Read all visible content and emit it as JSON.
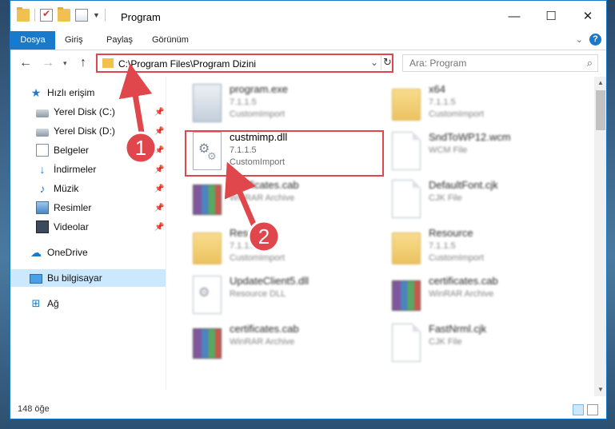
{
  "window": {
    "title": "Program"
  },
  "window_controls": {
    "minimize": "—",
    "maximize": "☐",
    "close": "✕"
  },
  "ribbon": {
    "tabs": [
      "Dosya",
      "Giriş",
      "Paylaş",
      "Görünüm"
    ],
    "help": "?"
  },
  "address": {
    "path": "C:\\Program Files\\Program Dizini",
    "refresh": "↻",
    "search_placeholder": "Ara: Program"
  },
  "nav": {
    "back": "←",
    "forward": "→",
    "recent": "▾",
    "up": "↑"
  },
  "sidebar": {
    "items": [
      {
        "label": "Hızlı erişim",
        "icon": "star-icon"
      },
      {
        "label": "Yerel Disk (C:)",
        "icon": "disk-icon",
        "pinned": true
      },
      {
        "label": "Yerel Disk (D:)",
        "icon": "disk-icon",
        "pinned": true
      },
      {
        "label": "Belgeler",
        "icon": "documents-icon",
        "pinned": true
      },
      {
        "label": "İndirmeler",
        "icon": "downloads-icon",
        "pinned": true
      },
      {
        "label": "Müzik",
        "icon": "music-icon",
        "pinned": true
      },
      {
        "label": "Resimler",
        "icon": "pictures-icon",
        "pinned": true
      },
      {
        "label": "Videolar",
        "icon": "videos-icon",
        "pinned": true
      },
      {
        "label": "OneDrive",
        "icon": "onedrive-icon"
      },
      {
        "label": "Bu bilgisayar",
        "icon": "computer-icon",
        "selected": true
      },
      {
        "label": "Ağ",
        "icon": "network-icon"
      }
    ]
  },
  "files": [
    {
      "name": "program.exe",
      "line2": "7.1.1.5",
      "line3": "CustomImport",
      "icon": "exe-icon"
    },
    {
      "name": "x64",
      "line2": "7.1.1.5",
      "line3": "CustomImport",
      "icon": "folder-icon"
    },
    {
      "name": "custmimp.dll",
      "line2": "7.1.1.5",
      "line3": "CustomImport",
      "icon": "dll-file-icon",
      "highlighted": true
    },
    {
      "name": "SndToWP12.wcm",
      "line2": "WCM File",
      "line3": "",
      "icon": "file-icon"
    },
    {
      "name": "certificates.cab",
      "line2": "WinRAR Archive",
      "line3": "",
      "icon": "archive-icon"
    },
    {
      "name": "DefaultFont.cjk",
      "line2": "CJK File",
      "line3": "",
      "icon": "file-icon"
    },
    {
      "name": "Resource",
      "line2": "7.1.1.5",
      "line3": "CustomImport",
      "icon": "folder-icon"
    },
    {
      "name": "Resource",
      "line2": "7.1.1.5",
      "line3": "CustomImport",
      "icon": "folder-icon"
    },
    {
      "name": "UpdateClient5.dll",
      "line2": "Resource DLL",
      "line3": "",
      "icon": "dll-file-icon"
    },
    {
      "name": "certificates.cab",
      "line2": "WinRAR Archive",
      "line3": "",
      "icon": "archive-icon"
    },
    {
      "name": "certificates.cab",
      "line2": "WinRAR Archive",
      "line3": "",
      "icon": "archive-icon"
    },
    {
      "name": "FastNrml.cjk",
      "line2": "CJK File",
      "line3": "",
      "icon": "file-icon"
    }
  ],
  "status": {
    "count": "148 öğe"
  },
  "annotations": {
    "badge1": "1",
    "badge2": "2"
  },
  "colors": {
    "accent": "#1979ca",
    "highlight": "#e0474c",
    "selection": "#cce8ff"
  }
}
